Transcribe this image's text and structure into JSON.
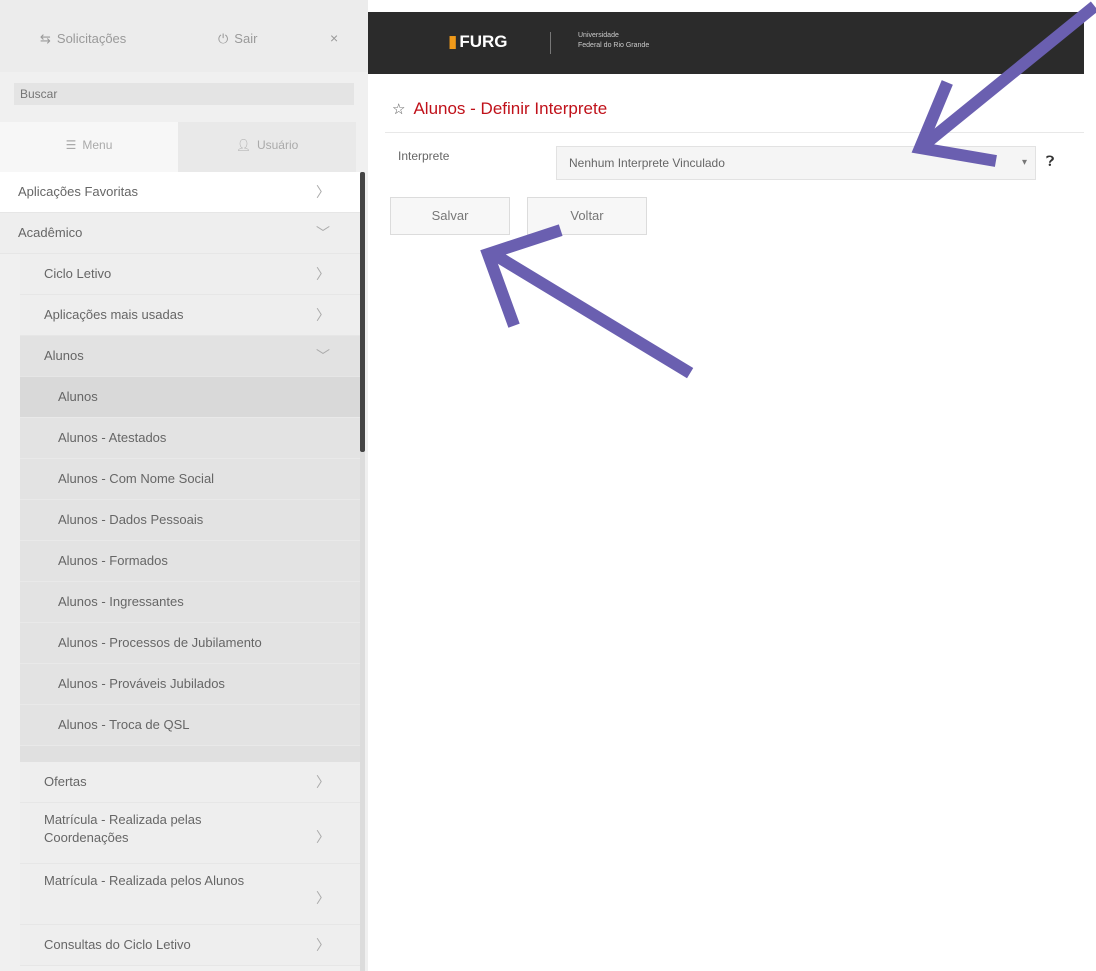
{
  "sidebar": {
    "requests_label": "Solicitações",
    "exit_label": "Sair",
    "close_glyph": "×",
    "search_placeholder": "Buscar",
    "tabs": [
      {
        "label": "Menu",
        "icon": "menu-icon"
      },
      {
        "label": "Usuário",
        "icon": "user-icon"
      }
    ],
    "menu": {
      "favorites": "Aplicações Favoritas",
      "academic": "Acadêmico",
      "academic_children": {
        "ciclo_letivo": "Ciclo Letivo",
        "mais_usadas": "Aplicações mais usadas",
        "alunos": "Alunos",
        "alunos_children": [
          "Alunos",
          "Alunos - Atestados",
          "Alunos - Com Nome Social",
          "Alunos - Dados Pessoais",
          "Alunos - Formados",
          "Alunos - Ingressantes",
          "Alunos - Processos de Jubilamento",
          "Alunos - Prováveis Jubilados",
          "Alunos - Troca de QSL"
        ],
        "after_alunos": [
          "Ofertas",
          "Matrícula - Realizada pelas Coordenações",
          "Matrícula - Realizada pelos Alunos",
          "Consultas do Ciclo Letivo"
        ]
      }
    }
  },
  "header": {
    "logo_text": "FURG",
    "logo_sub_line1": "Universidade",
    "logo_sub_line2": "Federal do Rio Grande"
  },
  "main": {
    "title": "Alunos - Definir Interprete",
    "field_label": "Interprete",
    "select_value": "Nenhum Interprete Vinculado",
    "help_glyph": "?",
    "save_label": "Salvar",
    "back_label": "Voltar"
  },
  "colors": {
    "title_red": "#c0111a",
    "topbar": "#2b2b2b",
    "annotation_arrow": "#6a5fb0"
  }
}
